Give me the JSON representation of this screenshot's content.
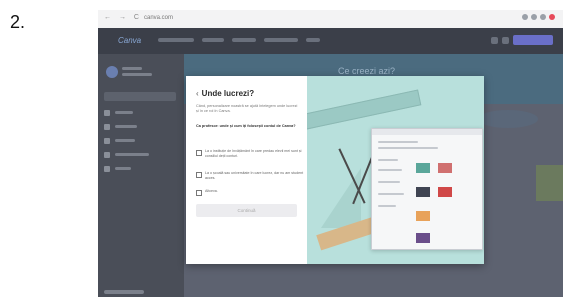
{
  "step": {
    "number": "2."
  },
  "browser": {
    "url": "canva.com",
    "nav": "← → C"
  },
  "app": {
    "logo": "Canva"
  },
  "hero": {
    "title": "Ce creezi azi?"
  },
  "modal": {
    "title": "Unde lucrezi?",
    "back_icon": "chevron-left-icon",
    "description": "Când, personalizare noastră se ajută întelegem unde lucrezi și în ce rol în Canva.",
    "question": "Ca profesor: unde și cum îți folosești contul de Canva?",
    "options": [
      {
        "label": "La o instituție de învățământ în care predau elevii mei sunt și consiliul deții conturi."
      },
      {
        "label": "La o școală sau universitate în care lucrez, dar nu am student acces."
      },
      {
        "label": "Altceva."
      }
    ],
    "continue_label": "Continuă"
  },
  "colors": {
    "accent": "#6a6fc8",
    "modal_illustration_bg": "#b8e0dc",
    "shell_dark": "#3b3f49"
  }
}
